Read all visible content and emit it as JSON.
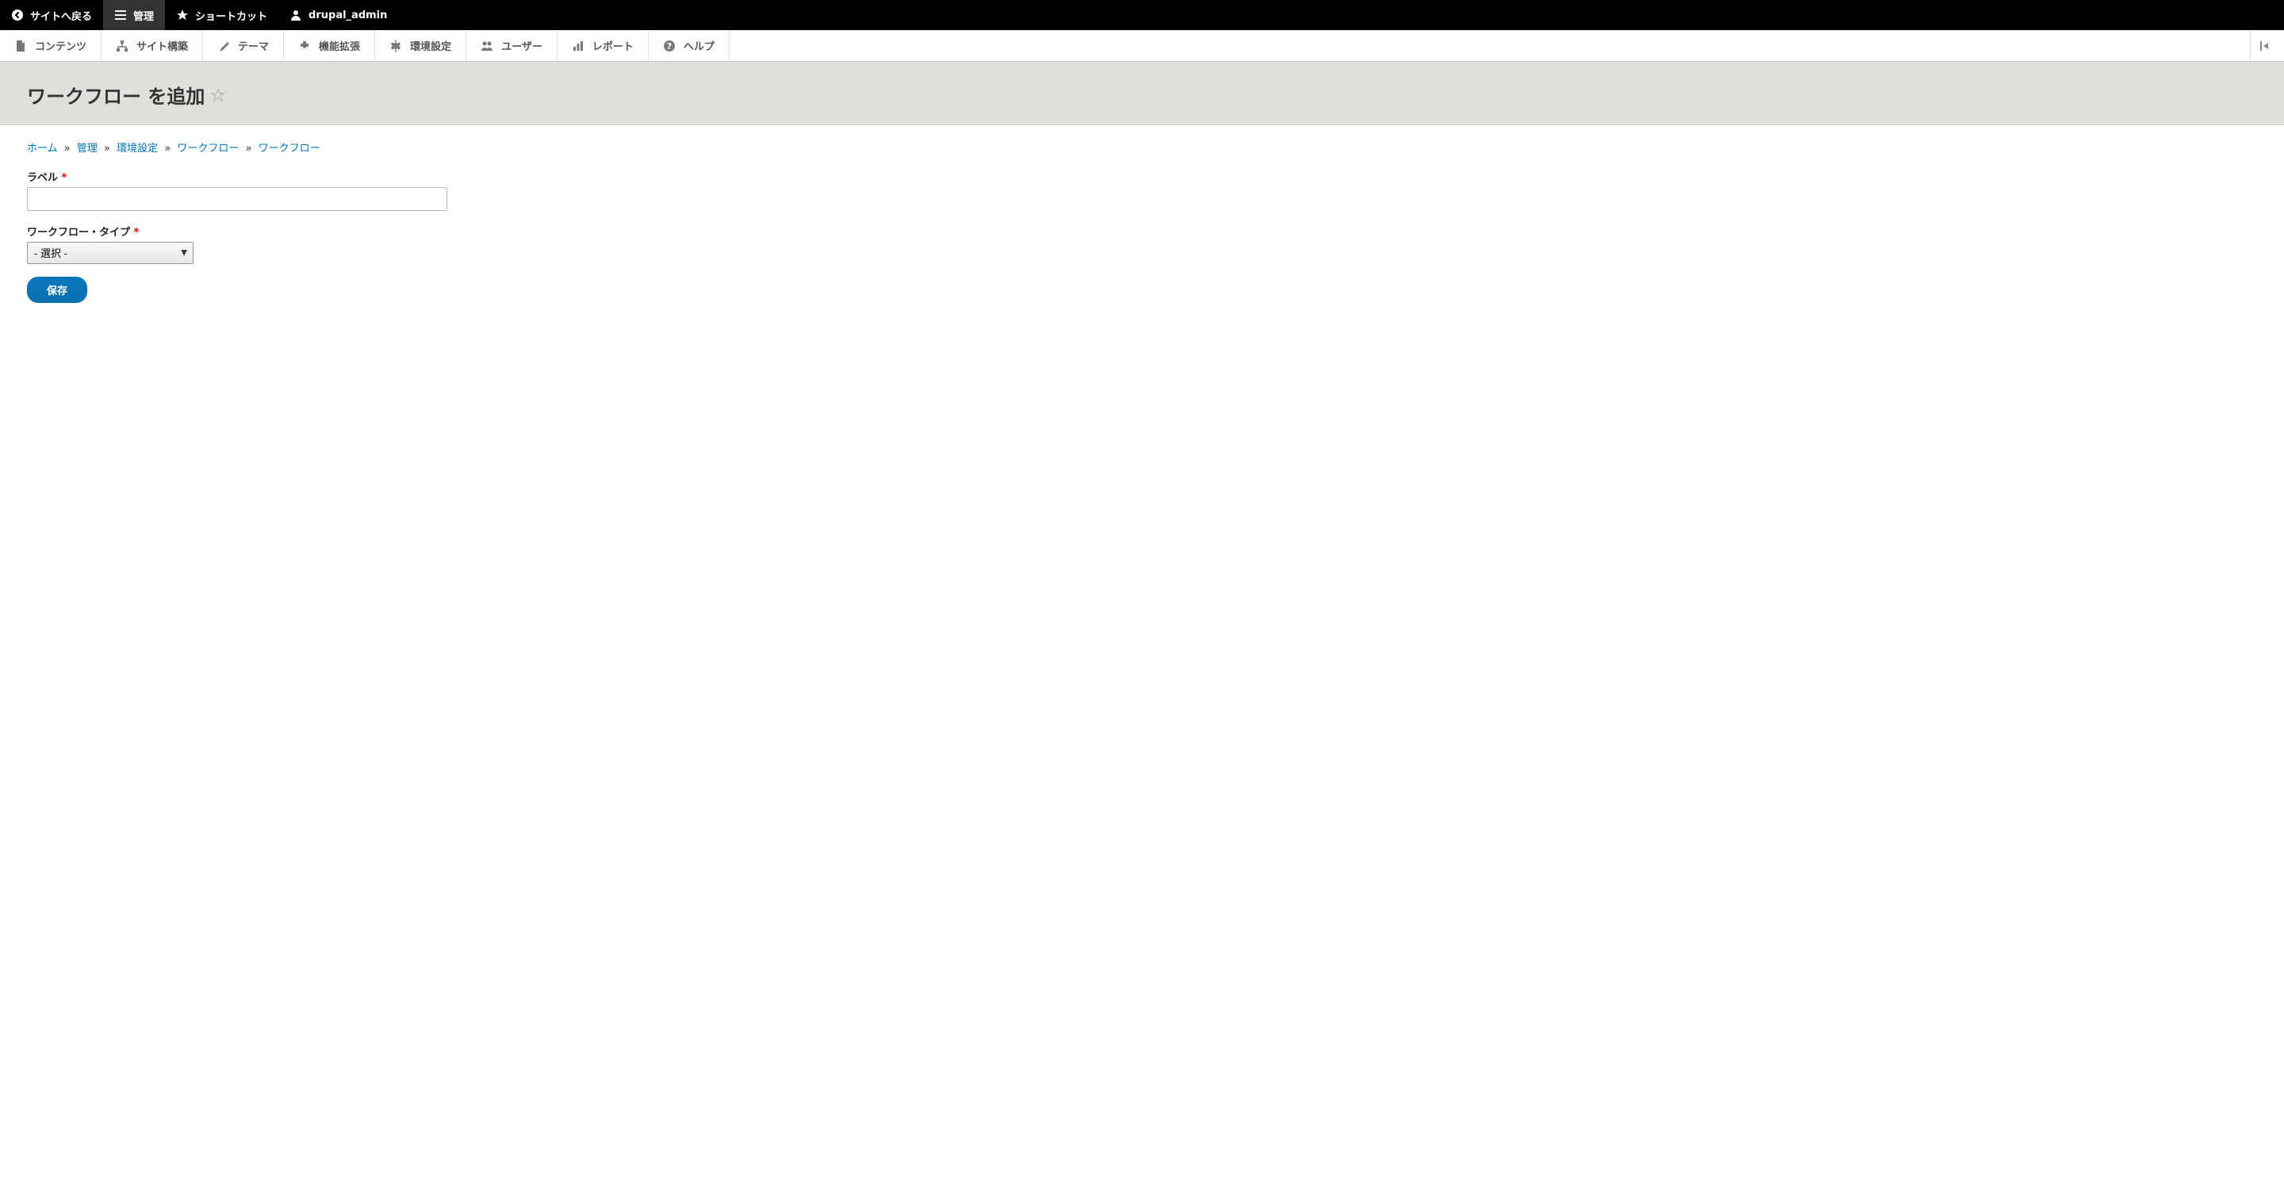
{
  "toolbar": {
    "back_to_site": "サイトへ戻る",
    "manage": "管理",
    "shortcuts": "ショートカット",
    "user": "drupal_admin"
  },
  "admin_menu": {
    "content": "コンテンツ",
    "structure": "サイト構築",
    "appearance": "テーマ",
    "extend": "機能拡張",
    "configuration": "環境設定",
    "people": "ユーザー",
    "reports": "レポート",
    "help": "ヘルプ"
  },
  "page": {
    "title": "ワークフロー を追加"
  },
  "breadcrumb": {
    "home": "ホーム",
    "admin": "管理",
    "config": "環境設定",
    "workflow": "ワークフロー",
    "workflows": "ワークフロー",
    "sep": "»"
  },
  "form": {
    "label_label": "ラベル",
    "label_value": "",
    "type_label": "ワークフロー・タイプ",
    "type_selected": "- 選択 -",
    "required_mark": "*",
    "submit": "保存"
  }
}
